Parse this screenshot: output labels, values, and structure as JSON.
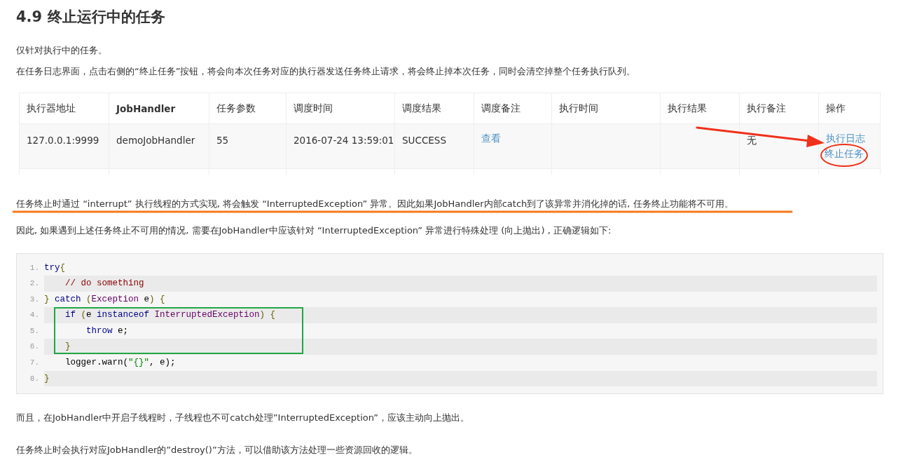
{
  "heading": "4.9 终止运行中的任务",
  "intro": [
    "仅针对执行中的任务。",
    "在任务日志界面，点击右侧的“终止任务”按钮，将会向本次任务对应的执行器发送任务终止请求，将会终止掉本次任务，同时会清空掉整个任务执行队列。"
  ],
  "table": {
    "columns": [
      {
        "label": "执行器地址",
        "bold": false
      },
      {
        "label": "JobHandler",
        "bold": true
      },
      {
        "label": "任务参数",
        "bold": false
      },
      {
        "label": "调度时间",
        "bold": false
      },
      {
        "label": "调度结果",
        "bold": false
      },
      {
        "label": "调度备注",
        "bold": false
      },
      {
        "label": "执行时间",
        "bold": false
      },
      {
        "label": "执行结果",
        "bold": false
      },
      {
        "label": "执行备注",
        "bold": false
      },
      {
        "label": "操作",
        "bold": false
      }
    ],
    "rows": [
      {
        "cells": [
          {
            "kind": "text",
            "text": "127.0.0.1:9999"
          },
          {
            "kind": "text",
            "text": "demoJobHandler"
          },
          {
            "kind": "text",
            "text": "55"
          },
          {
            "kind": "text",
            "text": "2016-07-24 13:59:01"
          },
          {
            "kind": "text",
            "text": "SUCCESS"
          },
          {
            "kind": "links",
            "links": [
              "查看"
            ]
          },
          {
            "kind": "empty"
          },
          {
            "kind": "empty"
          },
          {
            "kind": "text",
            "text": "无"
          },
          {
            "kind": "links",
            "links": [
              "执行日志",
              "终止任务"
            ]
          }
        ]
      }
    ]
  },
  "note": "任务终止时通过 “interrupt” 执行线程的方式实现, 将会触发 “InterruptedException” 异常。因此如果JobHandler内部catch到了该异常并消化掉的话, 任务终止功能将不可用。",
  "lead": "因此, 如果遇到上述任务终止不可用的情况, 需要在JobHandler中应该针对 “InterruptedException” 异常进行特殊处理 (向上抛出) , 正确逻辑如下:",
  "code": [
    {
      "number": "1.",
      "tokens": [
        {
          "kind": "kw",
          "t": "try"
        },
        {
          "kind": "pun",
          "t": "{"
        }
      ]
    },
    {
      "number": "2.",
      "tokens": [
        {
          "kind": "com",
          "t": "    // do something"
        }
      ]
    },
    {
      "number": "3.",
      "tokens": [
        {
          "kind": "pun",
          "t": "} "
        },
        {
          "kind": "kw",
          "t": "catch "
        },
        {
          "kind": "pun",
          "t": "("
        },
        {
          "kind": "typ",
          "t": "Exception"
        },
        {
          "kind": "pln",
          "t": " e"
        },
        {
          "kind": "pun",
          "t": ") {"
        }
      ]
    },
    {
      "number": "4.",
      "tokens": [
        {
          "kind": "kw",
          "t": "    if "
        },
        {
          "kind": "pun",
          "t": "("
        },
        {
          "kind": "pln",
          "t": "e "
        },
        {
          "kind": "kw",
          "t": "instanceof "
        },
        {
          "kind": "typ",
          "t": "InterruptedException"
        },
        {
          "kind": "pun",
          "t": ") {"
        }
      ]
    },
    {
      "number": "5.",
      "tokens": [
        {
          "kind": "kw",
          "t": "        throw"
        },
        {
          "kind": "pln",
          "t": " e;"
        }
      ]
    },
    {
      "number": "6.",
      "tokens": [
        {
          "kind": "pun",
          "t": "    }"
        }
      ]
    },
    {
      "number": "7.",
      "tokens": [
        {
          "kind": "pln",
          "t": "    logger.warn("
        },
        {
          "kind": "str",
          "t": "\"{}\""
        },
        {
          "kind": "pln",
          "t": ", e);"
        }
      ]
    },
    {
      "number": "8.",
      "tokens": [
        {
          "kind": "pun",
          "t": "}"
        }
      ]
    }
  ],
  "outro": [
    "而且，在JobHandler中开启子线程时，子线程也不可catch处理”InterruptedException”，应该主动向上抛出。",
    "任务终止时会执行对应JobHandler的”destroy()”方法，可以借助该方法处理一些资源回收的逻辑。"
  ]
}
